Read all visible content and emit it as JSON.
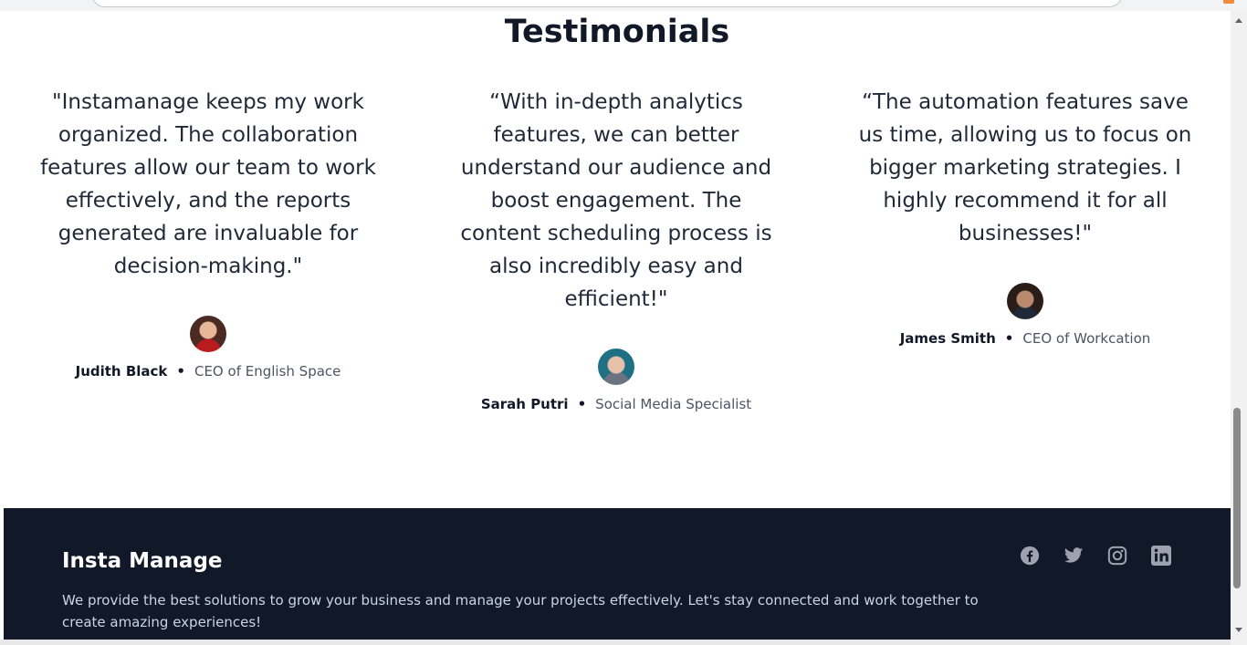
{
  "testimonials_section": {
    "title": "Testimonials",
    "items": [
      {
        "quote": "\"Instamanage keeps my work organized. The collaboration features allow our team to work effectively, and the reports generated are invaluable for decision-making.\"",
        "name": "Judith Black",
        "separator": "•",
        "role": "CEO of English Space",
        "avatar_icon": "woman-smiling-avatar"
      },
      {
        "quote": "“With in-depth analytics features, we can better understand our audience and boost engagement. The content scheduling process is also incredibly easy and efficient!\"",
        "name": "Sarah Putri",
        "separator": "•",
        "role": "Social Media Specialist",
        "avatar_icon": "woman-glasses-avatar"
      },
      {
        "quote": "“The automation features save us time, allowing us to focus on bigger marketing strategies. I highly recommend it for all businesses!\"",
        "name": "James Smith",
        "separator": "•",
        "role": "CEO of Workcation",
        "avatar_icon": "man-beard-avatar"
      }
    ]
  },
  "footer": {
    "brand": "Insta Manage",
    "description": "We provide the best solutions to grow your business and manage your projects effectively. Let's stay connected and work together to create amazing experiences!",
    "socials": [
      "facebook-icon",
      "twitter-icon",
      "instagram-icon",
      "linkedin-icon"
    ],
    "background_color": "#111827"
  },
  "colors": {
    "heading": "#111827",
    "body_text": "#1f2937",
    "muted": "#4b5563",
    "social_icon": "#9ca3af"
  }
}
